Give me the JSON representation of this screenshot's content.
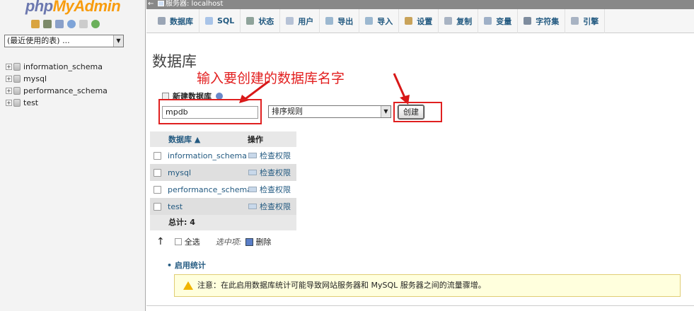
{
  "sidebar": {
    "logo_a": "php",
    "logo_b": "MyAdmin",
    "recent_label": "(最近使用的表) ...",
    "databases": [
      "information_schema",
      "mysql",
      "performance_schema",
      "test"
    ]
  },
  "topbar": {
    "server": "服务器: localhost"
  },
  "tabs": [
    {
      "label": "数据库",
      "color": "#9aa5b5"
    },
    {
      "label": "SQL",
      "color": "#a9c4e8"
    },
    {
      "label": "状态",
      "color": "#8fa39a"
    },
    {
      "label": "用户",
      "color": "#b6c2d6"
    },
    {
      "label": "导出",
      "color": "#9cb8d0"
    },
    {
      "label": "导入",
      "color": "#9cb8d0"
    },
    {
      "label": "设置",
      "color": "#c9a35a"
    },
    {
      "label": "复制",
      "color": "#a8b3c3"
    },
    {
      "label": "变量",
      "color": "#9fb0c7"
    },
    {
      "label": "字符集",
      "color": "#7e8c9e"
    },
    {
      "label": "引擎",
      "color": "#a8b3c3"
    }
  ],
  "main": {
    "title": "数据库",
    "annotation": "输入要创建的数据库名字",
    "create_header": "新建数据库",
    "db_name_value": "mpdb",
    "collation_label": "排序规则",
    "create_button": "创建"
  },
  "table": {
    "col_db": "数据库 ▲",
    "col_op": "操作",
    "rows": [
      {
        "name": "information_schema",
        "action": "检查权限"
      },
      {
        "name": "mysql",
        "action": "检查权限"
      },
      {
        "name": "performance_schema",
        "action": "检查权限"
      },
      {
        "name": "test",
        "action": "检查权限"
      }
    ],
    "total": "总计: 4"
  },
  "bulk": {
    "select_all": "全选",
    "with_selected": "选中项:",
    "delete": "删除"
  },
  "stats_link": "启用统计",
  "notice": "注意：在此启用数据库统计可能导致网站服务器和 MySQL 服务器之间的流量骤增。"
}
